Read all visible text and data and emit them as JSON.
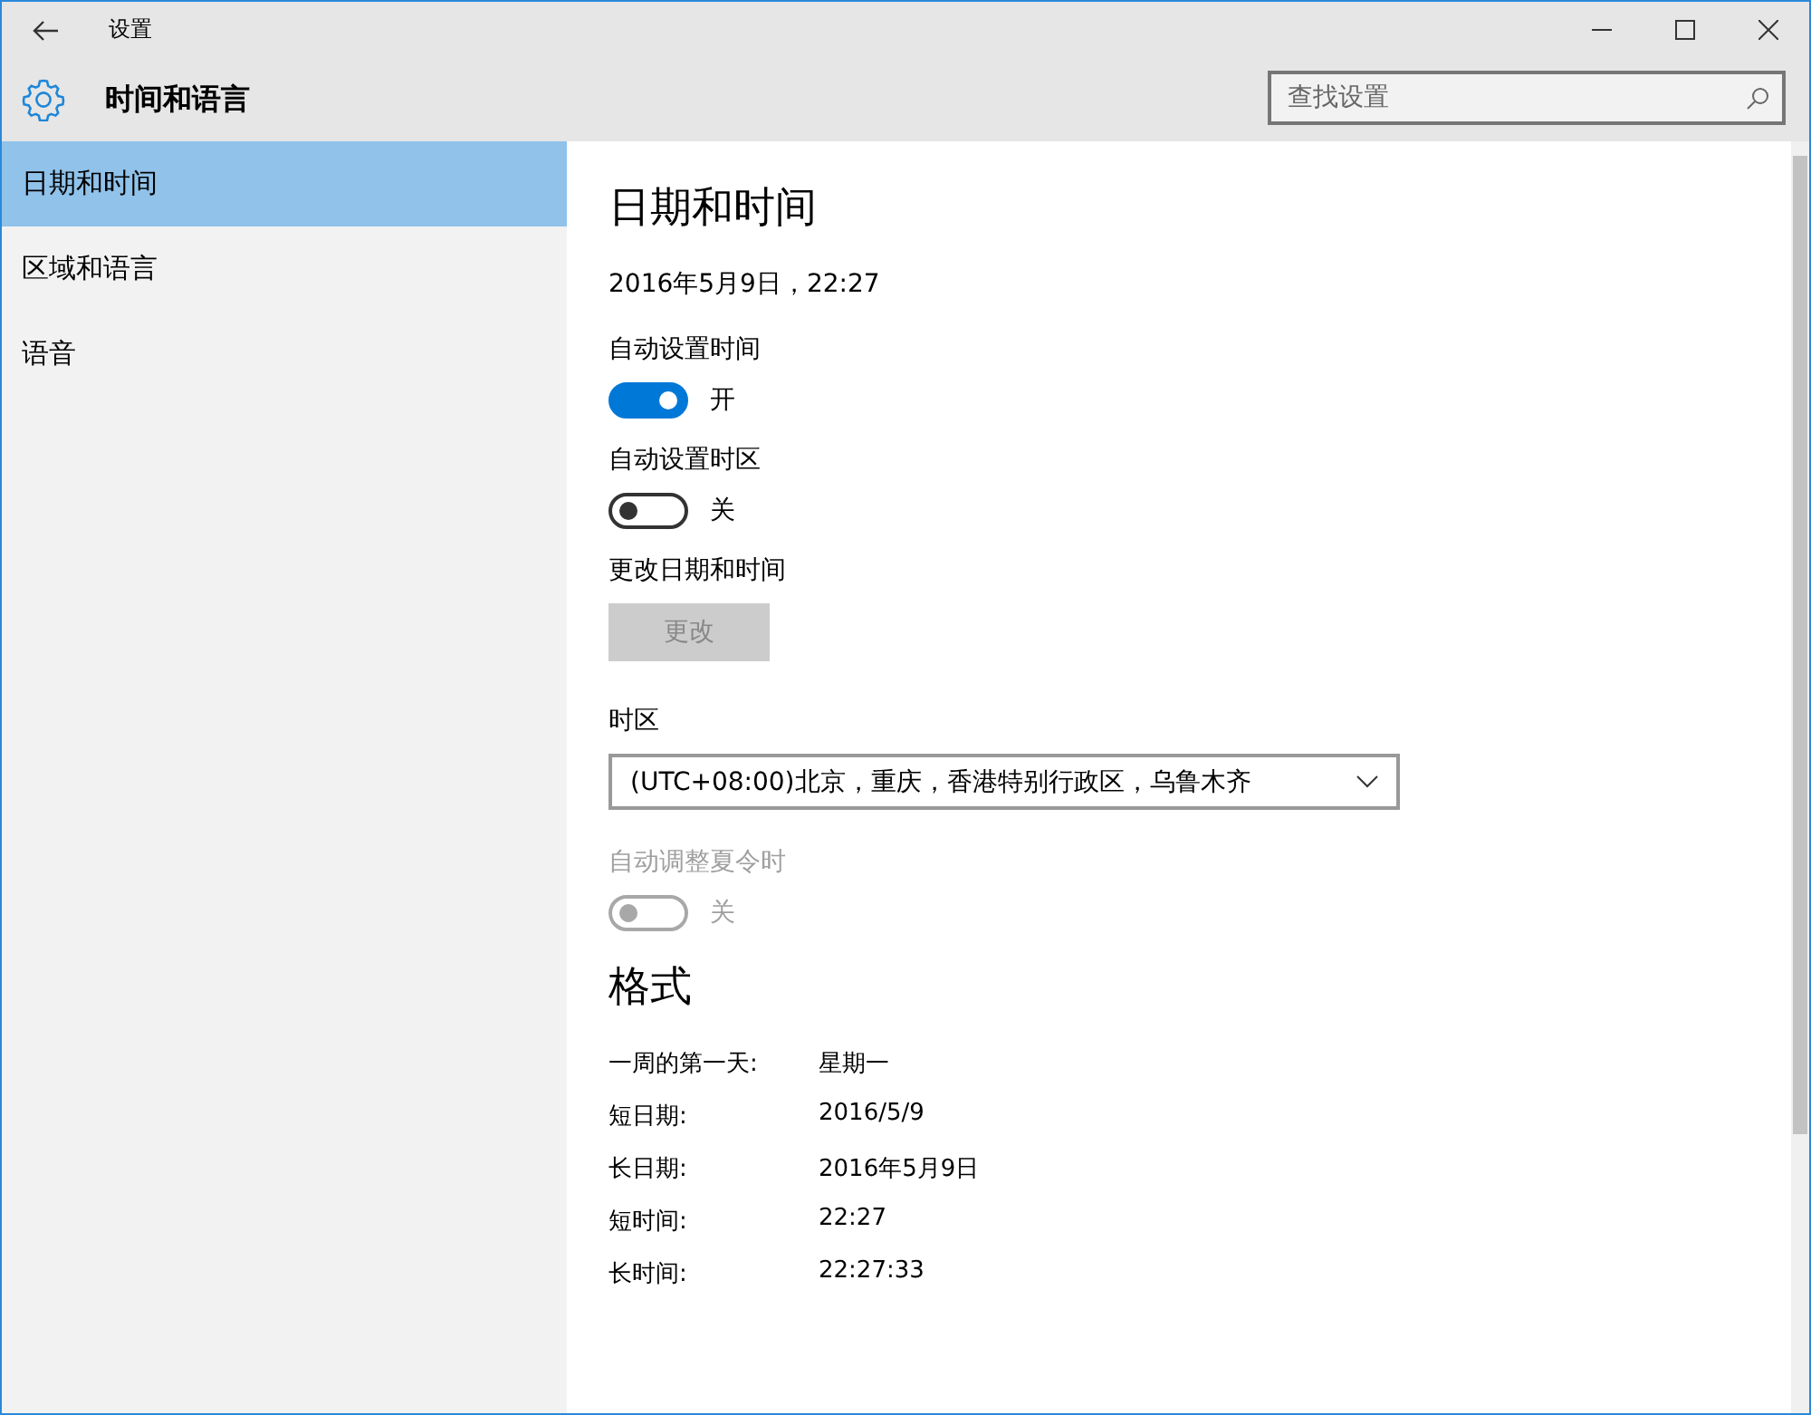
{
  "window": {
    "title": "设置"
  },
  "header": {
    "title": "时间和语言"
  },
  "search": {
    "placeholder": "查找设置"
  },
  "sidebar": {
    "items": [
      {
        "label": "日期和时间",
        "selected": true
      },
      {
        "label": "区域和语言",
        "selected": false
      },
      {
        "label": "语音",
        "selected": false
      }
    ]
  },
  "content": [
    {
      "kind": "heading",
      "text": "日期和时间"
    },
    {
      "kind": "text",
      "text": "2016年5月9日，22:27"
    },
    {
      "kind": "toggle",
      "label": "自动设置时间",
      "on": true,
      "disabled": false,
      "state_text": "开"
    },
    {
      "kind": "toggle",
      "label": "自动设置时区",
      "on": false,
      "disabled": false,
      "state_text": "关"
    },
    {
      "kind": "button",
      "label": "更改日期和时间",
      "button": "更改",
      "disabled": true
    },
    {
      "kind": "dropdown",
      "label": "时区",
      "value": "(UTC+08:00)北京，重庆，香港特别行政区，乌鲁木齐"
    },
    {
      "kind": "toggle",
      "label": "自动调整夏令时",
      "on": false,
      "disabled": true,
      "state_text": "关"
    },
    {
      "kind": "heading",
      "text": "格式"
    },
    {
      "kind": "pairs",
      "rows": [
        {
          "key": "一周的第一天:",
          "value": "星期一"
        },
        {
          "key": "短日期:",
          "value": "2016/5/9"
        },
        {
          "key": "长日期:",
          "value": "2016年5月9日"
        },
        {
          "key": "短时间:",
          "value": "22:27"
        },
        {
          "key": "长时间:",
          "value": "22:27:33"
        }
      ]
    }
  ]
}
